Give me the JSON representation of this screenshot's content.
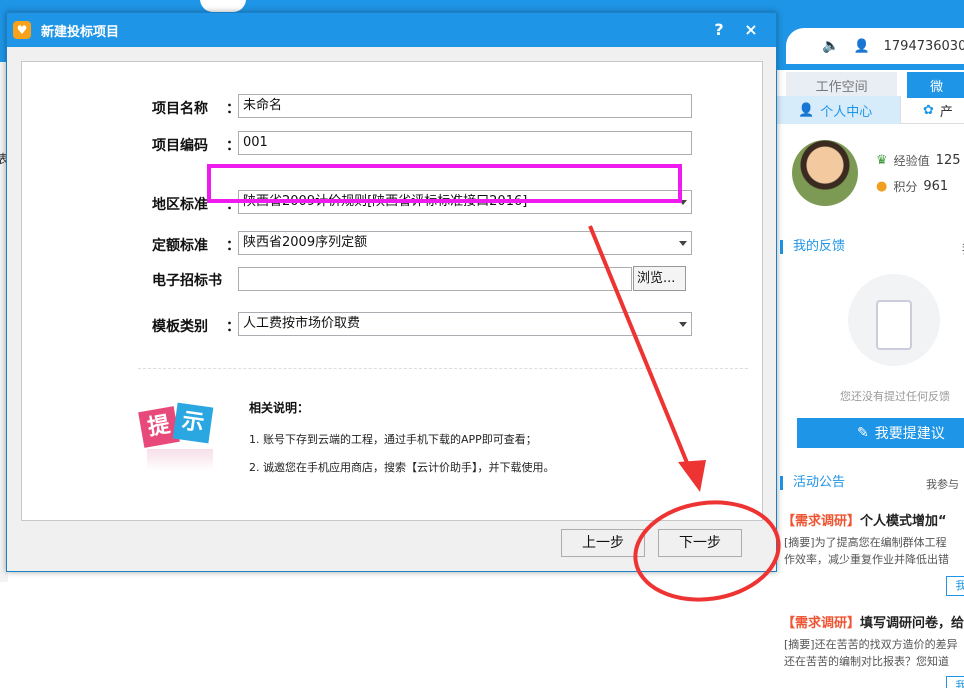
{
  "background": {
    "right_panel": {
      "user_id": "1794736030",
      "tabs": [
        {
          "label": "工作空间"
        },
        {
          "label": "微"
        }
      ],
      "subtabs": [
        {
          "label": "个人中心"
        },
        {
          "label": "产"
        }
      ],
      "stats": [
        {
          "label": "经验值",
          "value": "125"
        },
        {
          "label": "积分",
          "value": "961"
        }
      ],
      "feedback": {
        "title": "我的反馈",
        "more": "我",
        "empty_text": "您还没有提过任何反馈",
        "button": "我要提建议"
      },
      "activity": {
        "title": "活动公告",
        "more": "我参与"
      },
      "news": [
        {
          "tag": "【需求调研】",
          "title": "个人模式增加“",
          "desc1": "[摘要]为了提高您在编制群体工程",
          "desc2": "作效率，减少重复作业并降低出错",
          "btn": "我"
        },
        {
          "tag": "【需求调研】",
          "title": "填写调研问卷，给",
          "desc1": "[摘要]还在苦苦的找双方造价的差异",
          "desc2": "还在苦苦的编制对比报表？您知道",
          "btn": "我"
        }
      ]
    },
    "left_char": "表"
  },
  "dialog": {
    "title": "新建投标项目",
    "help": "?",
    "close": "×",
    "fields": {
      "project_name": {
        "label": "项目名称",
        "colon": "：",
        "value": "未命名"
      },
      "project_code": {
        "label": "项目编码",
        "colon": "：",
        "value": "001"
      },
      "region": {
        "label": "地区标准",
        "colon": "：",
        "value": "陕西省2009计价规则[陕西省评标标准接口2016]"
      },
      "quota": {
        "label": "定额标准",
        "colon": "：",
        "value": "陕西省2009序列定额"
      },
      "etender": {
        "label": "电子招标书",
        "value": "",
        "browse": "浏览..."
      },
      "template": {
        "label": "模板类别",
        "colon": "：",
        "value": "人工费按市场价取费"
      }
    },
    "notes": {
      "icon_a": "提",
      "icon_b": "示",
      "title": "相关说明：",
      "lines": [
        "1. 账号下存到云端的工程，通过手机下载的APP即可查看；",
        "2. 诚邀您在手机应用商店，搜索【云计价助手】，并下载使用。"
      ]
    },
    "buttons": {
      "prev": "上一步",
      "next": "下一步"
    }
  },
  "colors": {
    "accent": "#1e95e6",
    "highlight": "#ee1aee",
    "annotation": "#ee3333"
  }
}
